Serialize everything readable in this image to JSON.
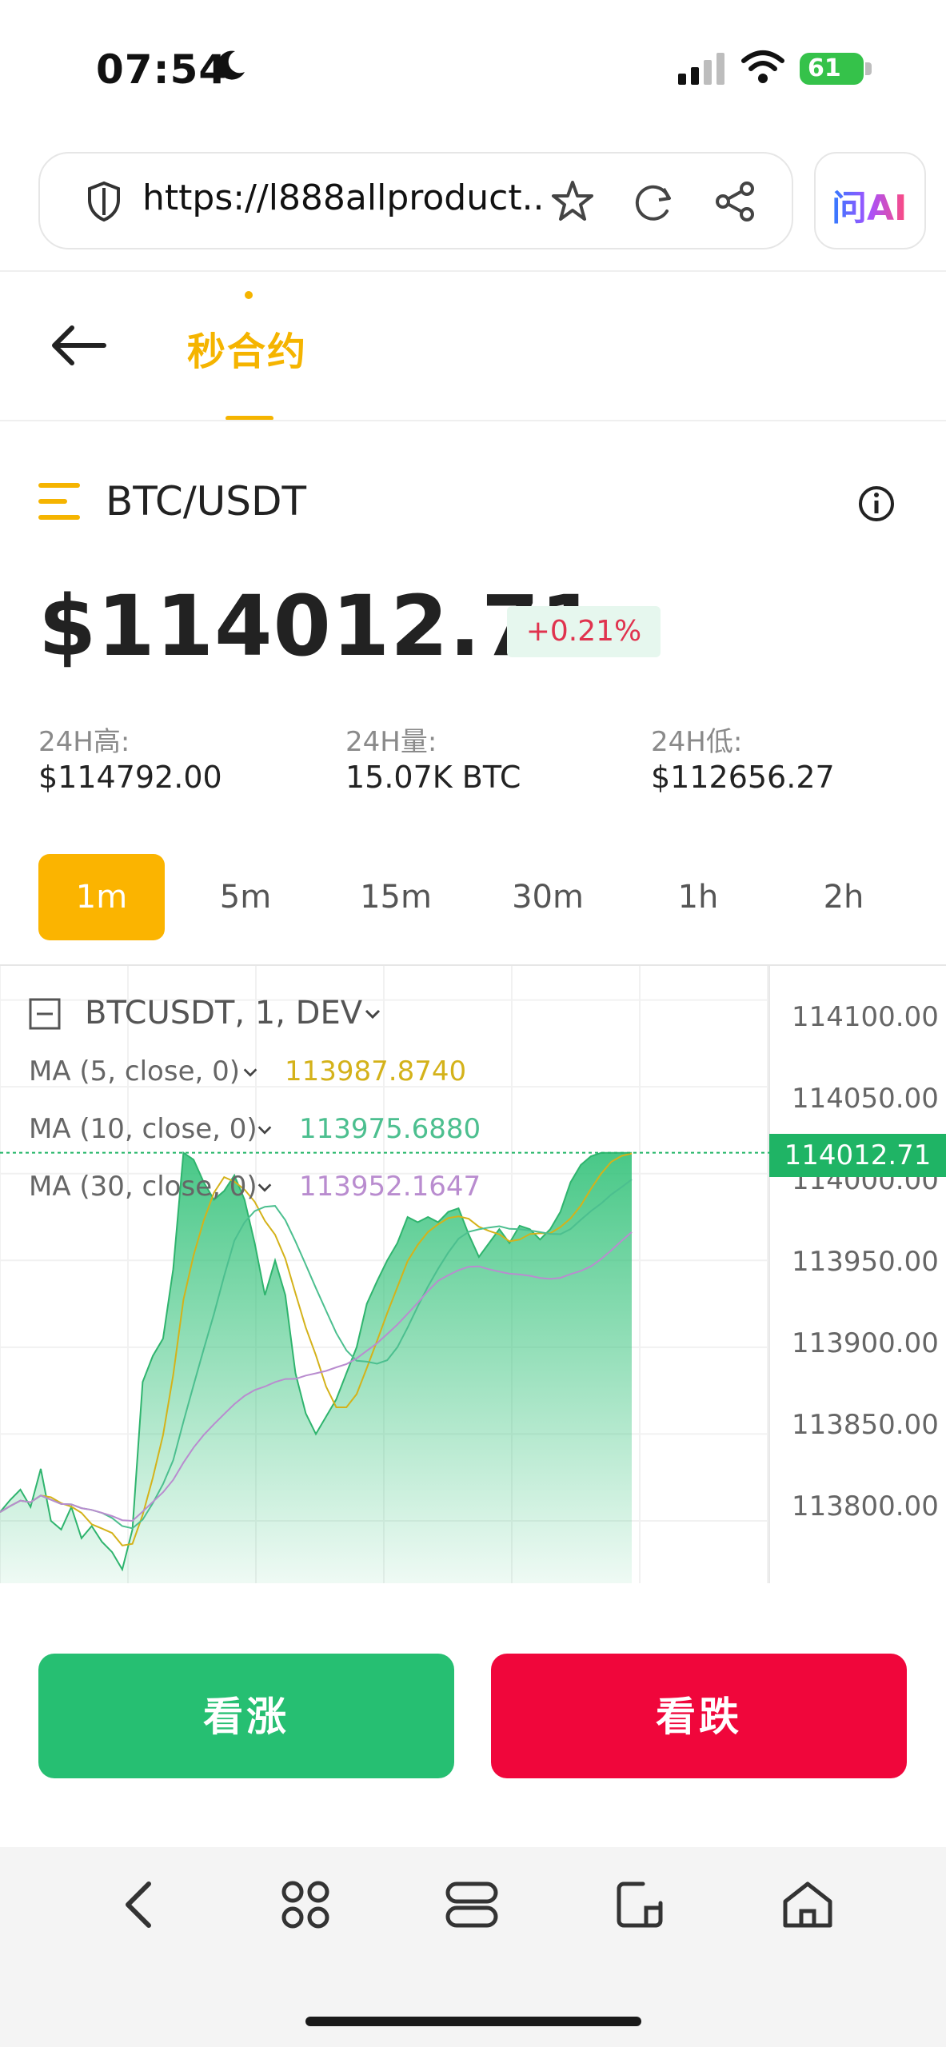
{
  "status_bar": {
    "time": "07:54",
    "battery": "61"
  },
  "browser": {
    "url": "https://l888allproduct..",
    "ai_label": "问AI"
  },
  "nav": {
    "title": "秒合约"
  },
  "market": {
    "pair": "BTC/USDT",
    "price": "$114012.71",
    "change": "+0.21%",
    "stats": [
      {
        "label": "24H高:",
        "value": "$114792.00"
      },
      {
        "label": "24H量:",
        "value": "15.07K BTC"
      },
      {
        "label": "24H低:",
        "value": "$112656.27"
      }
    ]
  },
  "intervals": [
    "1m",
    "5m",
    "15m",
    "30m",
    "1h",
    "2h"
  ],
  "active_interval": "1m",
  "chart": {
    "title": "BTCUSDT, 1, DEV",
    "indicators": [
      {
        "label": "MA (5, close, 0)",
        "value": "113987.8740",
        "color": "#d4b21a"
      },
      {
        "label": "MA (10, close, 0)",
        "value": "113975.6880",
        "color": "#4cbf8f"
      },
      {
        "label": "MA (30, close, 0)",
        "value": "113952.1647",
        "color": "#b98ccf"
      }
    ],
    "y_ticks": [
      "114100.00",
      "114050.00",
      "114000.00",
      "113950.00",
      "113900.00",
      "113850.00",
      "113800.00"
    ],
    "current_price_tag": "114012.71"
  },
  "chart_data": {
    "type": "area",
    "title": "BTCUSDT, 1, DEV",
    "ylim": [
      113765,
      114115
    ],
    "x": [
      0,
      1,
      2,
      3,
      4,
      5,
      6,
      7,
      8,
      9,
      10,
      11,
      12,
      13,
      14,
      15,
      16,
      17,
      18,
      19,
      20,
      21,
      22,
      23,
      24,
      25,
      26,
      27,
      28,
      29,
      30,
      31,
      32,
      33,
      34,
      35,
      36,
      37,
      38,
      39,
      40,
      41,
      42,
      43,
      44,
      45,
      46,
      47,
      48,
      49,
      50,
      51,
      52,
      53,
      54,
      55,
      56,
      57,
      58,
      59,
      60,
      61,
      62
    ],
    "series": [
      {
        "values": [
          113805,
          113812,
          113818,
          113808,
          113830,
          113800,
          113795,
          113808,
          113790,
          113797,
          113788,
          113782,
          113772,
          113795,
          113880,
          113895,
          113905,
          113945,
          114012,
          114008,
          113995,
          113985,
          113990,
          113999,
          113985,
          113960,
          113930,
          113950,
          113930,
          113885,
          113862,
          113850,
          113860,
          113870,
          113885,
          113900,
          113925,
          113938,
          113950,
          113960,
          113975,
          113972,
          113975,
          113972,
          113978,
          113980,
          113965,
          113952,
          113960,
          113968,
          113960,
          113970,
          113968,
          113962,
          113968,
          113978,
          113995,
          114005,
          114010,
          114012,
          114012,
          114012,
          114012
        ]
      }
    ],
    "ma": [
      {
        "name": "MA (5, close, 0)",
        "last": 113987.874
      },
      {
        "name": "MA (10, close, 0)",
        "last": 113975.688
      },
      {
        "name": "MA (30, close, 0)",
        "last": 113952.1647
      }
    ]
  },
  "actions": {
    "up": "看涨",
    "down": "看跌"
  },
  "colors": {
    "accent": "#f5b400",
    "up": "#26bf72",
    "down": "#f0063b"
  }
}
